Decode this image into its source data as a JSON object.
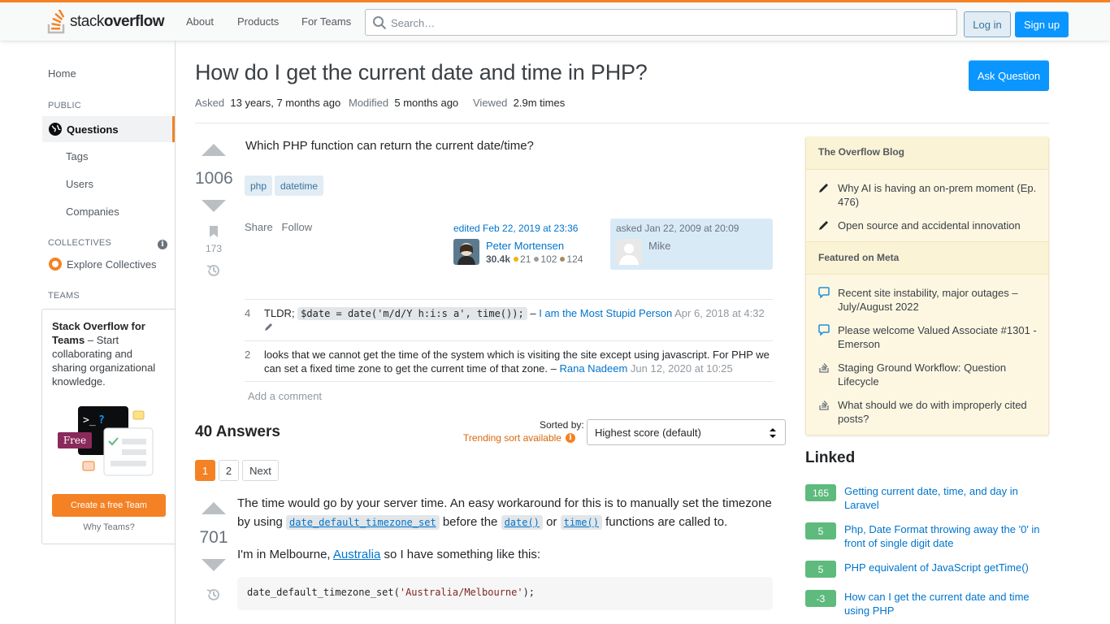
{
  "header": {
    "logo_text_light": "stack",
    "logo_text_bold": "overflow",
    "nav": [
      "About",
      "Products",
      "For Teams"
    ],
    "search_placeholder": "Search…",
    "login": "Log in",
    "signup": "Sign up"
  },
  "leftnav": {
    "home": "Home",
    "public": "PUBLIC",
    "questions": "Questions",
    "tags": "Tags",
    "users": "Users",
    "companies": "Companies",
    "collectives_head": "COLLECTIVES",
    "explore_collectives": "Explore Collectives",
    "teams_head": "TEAMS",
    "teams_title": "Stack Overflow for Teams",
    "teams_desc": " – Start collaborating and sharing organizational knowledge.",
    "free_badge": "Free",
    "create_team": "Create a free Team",
    "why_teams": "Why Teams?"
  },
  "question": {
    "title": "How do I get the current date and time in PHP?",
    "ask_button": "Ask Question",
    "asked_label": "Asked",
    "asked_value": "13 years, 7 months ago",
    "modified_label": "Modified",
    "modified_value": "5 months ago",
    "viewed_label": "Viewed",
    "viewed_value": "2.9m times",
    "score": "1006",
    "bookmarks": "173",
    "body": "Which PHP function can return the current date/time?",
    "tags": [
      "php",
      "datetime"
    ],
    "share": "Share",
    "follow": "Follow",
    "edited": "edited Feb 22, 2019 at 23:36",
    "editor_name": "Peter Mortensen",
    "editor_rep": "30.4k",
    "editor_gold": "21",
    "editor_silver": "102",
    "editor_bronze": "124",
    "asked_on": "asked Jan 22, 2009 at 20:09",
    "asker_name": "Mike",
    "comments": [
      {
        "score": "4",
        "pre": "TLDR; ",
        "code": "$date = date('m/d/Y h:i:s a', time());",
        "sep": " – ",
        "user": "I am the Most Stupid Person",
        "date": " Apr 6, 2018 at 4:32"
      },
      {
        "score": "2",
        "text": "looks that we cannot get the time of the system which is visiting the site except using javascript. For PHP we can set a fixed time zone to get the current time of that zone. – ",
        "user": "Rana Nadeem",
        "date": " Jun 12, 2020 at 10:25"
      }
    ],
    "add_comment": "Add a comment"
  },
  "answers": {
    "heading": "40 Answers",
    "sorted_by": "Sorted by:",
    "trending": "Trending sort available",
    "sort_value": "Highest score (default)",
    "pages": [
      "1",
      "2",
      "Next"
    ],
    "top_score": "701",
    "p1_a": "The time would go by your server time. An easy workaround for this is to manually set the timezone by using ",
    "p1_code1": "date_default_timezone_set",
    "p1_b": " before the ",
    "p1_code2": "date()",
    "p1_c": " or ",
    "p1_code3": "time()",
    "p1_d": " functions are called to.",
    "p2_a": "I'm in Melbourne, ",
    "p2_link": "Australia",
    "p2_b": " so I have something like this:",
    "code_fn": "date_default_timezone_set(",
    "code_str": "'Australia/Melbourne'",
    "code_end": ");"
  },
  "sidebar": {
    "blog_head": "The Overflow Blog",
    "blog_items": [
      "Why AI is having an on-prem moment (Ep. 476)",
      "Open source and accidental innovation"
    ],
    "meta_head": "Featured on Meta",
    "meta_items": [
      "Recent site instability, major outages – July/August 2022",
      "Please welcome Valued Associate #1301 - Emerson",
      "Staging Ground Workflow: Question Lifecycle",
      "What should we do with improperly cited posts?"
    ],
    "linked_head": "Linked",
    "linked": [
      {
        "score": "165",
        "title": "Getting current date, time, and day in Laravel"
      },
      {
        "score": "5",
        "title": "Php, Date Format throwing away the '0' in front of single digit date"
      },
      {
        "score": "5",
        "title": "PHP equivalent of JavaScript getTime()"
      },
      {
        "score": "-3",
        "title": "How can I get the current date and time using PHP"
      }
    ]
  },
  "colors": {
    "accent": "#f48225",
    "link": "#0074cc",
    "primary_button": "#0a95ff",
    "accepted_green": "#5eba7d"
  }
}
